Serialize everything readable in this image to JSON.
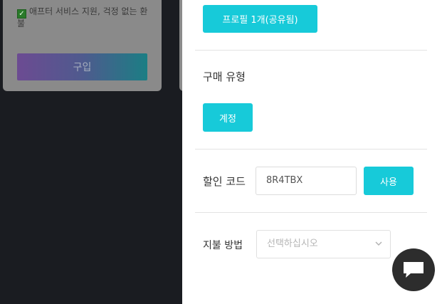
{
  "background": {
    "feature_text": "애프터 서비스 지원, 걱정 없는 환불",
    "buy_label": "구입"
  },
  "panel": {
    "profile_button": "프로필 1개(공유됨)",
    "purchase_type_label": "구매 유형",
    "account_button": "계정",
    "coupon_label": "할인 코드",
    "coupon_value": "8R4TBX",
    "apply_button": "사용",
    "payment_label": "지불 방법",
    "payment_placeholder": "선택하십시오"
  },
  "colors": {
    "accent": "#17cad9",
    "overlay": "#1a1c21"
  },
  "icons": {
    "chat": "chat-bubble-icon",
    "chevron": "chevron-down-icon",
    "check": "checkbox-checked-icon"
  }
}
